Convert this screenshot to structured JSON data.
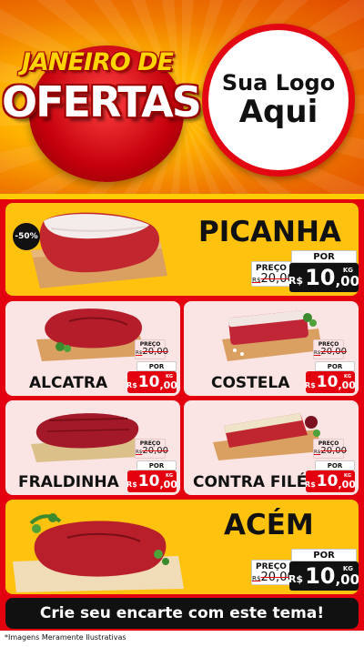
{
  "header": {
    "title_line1": "JANEIRO DE",
    "title_line2": "OFERTAS",
    "logo_line1": "Sua Logo",
    "logo_line2": "Aqui"
  },
  "products": {
    "picanha": {
      "name": "PICANHA",
      "badge": "-50%",
      "old_label": "PREÇO",
      "old_prefix": "R$",
      "old_price": "20,00",
      "por_label": "POR",
      "currency": "R$",
      "price_int": "10",
      "price_dec": ",00",
      "unit": "KG"
    },
    "alcatra": {
      "name": "ALCATRA",
      "old_label": "PREÇO",
      "old_prefix": "R$",
      "old_price": "20,00",
      "por_label": "POR",
      "currency": "R$",
      "price_int": "10",
      "price_dec": ",00",
      "unit": "KG"
    },
    "costela": {
      "name": "COSTELA",
      "old_label": "PREÇO",
      "old_prefix": "R$",
      "old_price": "20,00",
      "por_label": "POR",
      "currency": "R$",
      "price_int": "10",
      "price_dec": ",00",
      "unit": "KG"
    },
    "fraldinha": {
      "name": "FRALDINHA",
      "old_label": "PREÇO",
      "old_prefix": "R$",
      "old_price": "20,00",
      "por_label": "POR",
      "currency": "R$",
      "price_int": "10",
      "price_dec": ",00",
      "unit": "KG"
    },
    "contra_file": {
      "name": "CONTRA FILÉ",
      "old_label": "PREÇO",
      "old_prefix": "R$",
      "old_price": "20,00",
      "por_label": "POR",
      "currency": "R$",
      "price_int": "10",
      "price_dec": ",00",
      "unit": "KG"
    },
    "acem": {
      "name": "ACÉM",
      "old_label": "PREÇO",
      "old_prefix": "R$",
      "old_price": "20,00",
      "por_label": "POR",
      "currency": "R$",
      "price_int": "10",
      "price_dec": ",00",
      "unit": "KG"
    }
  },
  "cta": {
    "label": "Crie seu encarte com este tema!"
  },
  "footer": {
    "note": "*Imagens Meramente Ilustrativas"
  },
  "colors": {
    "brand_red": "#e3000f",
    "brand_yellow": "#ffc20e",
    "dark": "#111111",
    "light_card": "#fbe4e4"
  }
}
